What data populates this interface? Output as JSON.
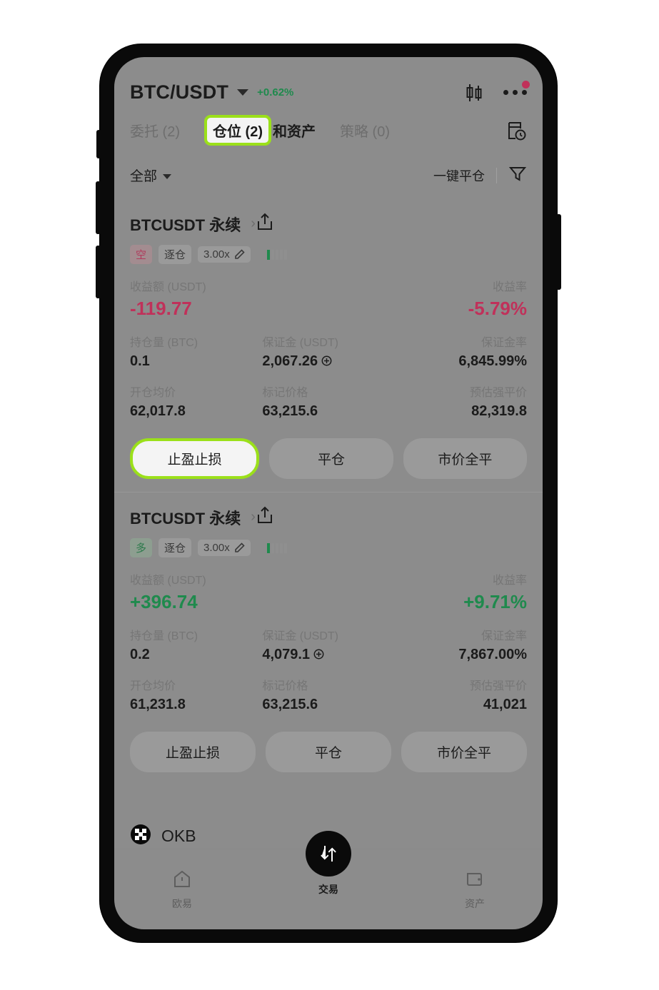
{
  "header": {
    "pair": "BTC/USDT",
    "change": "+0.62%",
    "chart_icon": "candlestick-icon",
    "more_icon": "more-options-icon"
  },
  "tabs": {
    "orders": "委托 (2)",
    "positions": "仓位 (2)",
    "positions_suffix": "和资产",
    "strategies": "策略 (0)",
    "history_icon": "order-history-icon"
  },
  "filter": {
    "all_label": "全部",
    "close_all_label": "一键平仓",
    "funnel_icon": "funnel-filter-icon"
  },
  "positions": [
    {
      "instrument": "BTCUSDT 永续",
      "side": "空",
      "side_type": "short",
      "margin_mode": "逐仓",
      "leverage": "3.00x",
      "pnl_label": "收益额 (USDT)",
      "pnl_value": "-119.77",
      "pnl_sign": "neg",
      "pnl_rate_label": "收益率",
      "pnl_rate_value": "-5.79%",
      "size_label": "持仓量 (BTC)",
      "size_value": "0.1",
      "margin_label": "保证金 (USDT)",
      "margin_value": "2,067.26",
      "margin_ratio_label": "保证金率",
      "margin_ratio_value": "6,845.99%",
      "avg_price_label": "开仓均价",
      "avg_price_value": "62,017.8",
      "mark_price_label": "标记价格",
      "mark_price_value": "63,215.6",
      "liq_price_label": "预估强平价",
      "liq_price_value": "82,319.8",
      "buttons": [
        "止盈止损",
        "平仓",
        "市价全平"
      ],
      "highlighted_button_index": 0
    },
    {
      "instrument": "BTCUSDT 永续",
      "side": "多",
      "side_type": "long",
      "margin_mode": "逐仓",
      "leverage": "3.00x",
      "pnl_label": "收益额 (USDT)",
      "pnl_value": "+396.74",
      "pnl_sign": "pos",
      "pnl_rate_label": "收益率",
      "pnl_rate_value": "+9.71%",
      "size_label": "持仓量 (BTC)",
      "size_value": "0.2",
      "margin_label": "保证金 (USDT)",
      "margin_value": "4,079.1",
      "margin_ratio_label": "保证金率",
      "margin_ratio_value": "7,867.00%",
      "avg_price_label": "开仓均价",
      "avg_price_value": "61,231.8",
      "mark_price_label": "标记价格",
      "mark_price_value": "63,215.6",
      "liq_price_label": "预估强平价",
      "liq_price_value": "41,021",
      "buttons": [
        "止盈止损",
        "平仓",
        "市价全平"
      ],
      "highlighted_button_index": -1
    }
  ],
  "token_row": {
    "symbol": "OKB",
    "logo_icon": "okb-logo-icon"
  },
  "bottom_nav": {
    "home": "欧易",
    "trade": "交易",
    "assets": "资产"
  },
  "colors": {
    "highlight_green": "#9be01a",
    "positive": "#1f8a4d",
    "negative": "#c0315a",
    "screen_bg": "#8c8c8c"
  }
}
